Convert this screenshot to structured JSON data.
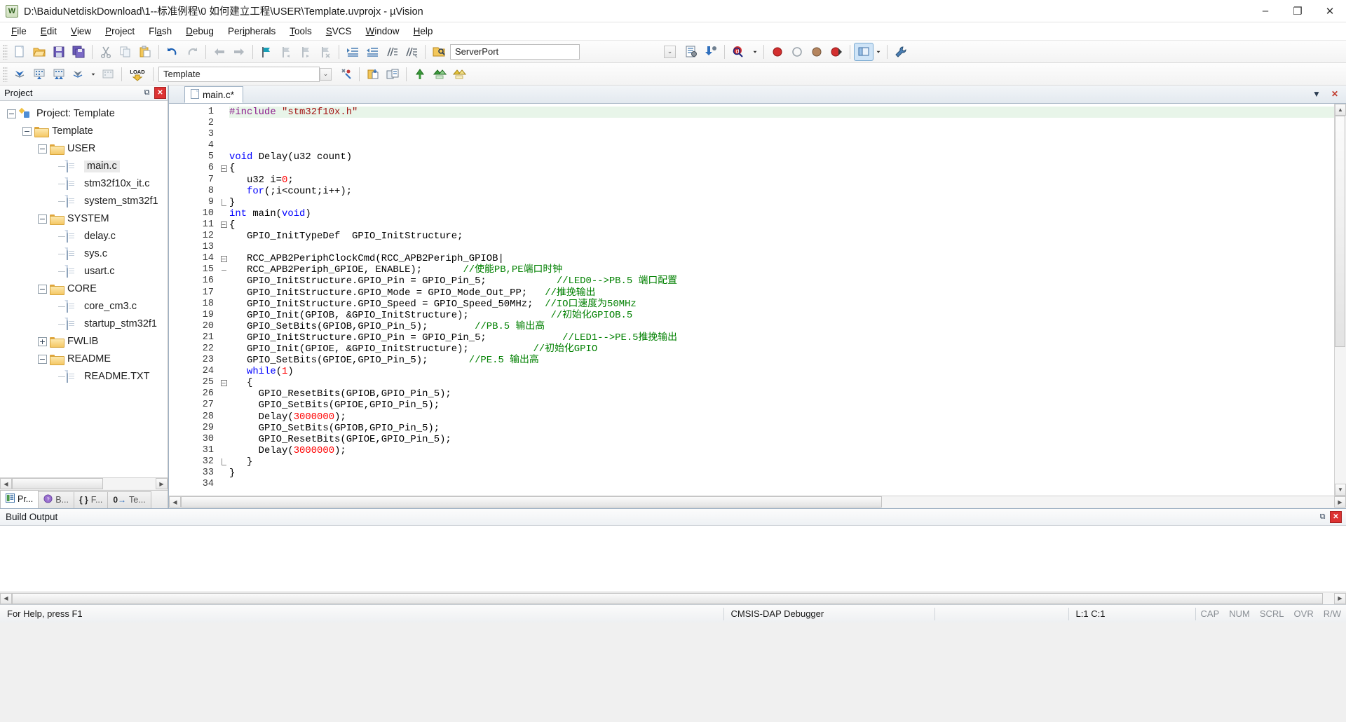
{
  "window": {
    "title": "D:\\BaiduNetdiskDownload\\1--标准例程\\0 如何建立工程\\USER\\Template.uvprojx - µVision",
    "app_icon": "uvision-logo-icon",
    "minimize": "–",
    "maximize": "❐",
    "close": "✕"
  },
  "menubar": [
    {
      "label": "File",
      "mnemonic": "F"
    },
    {
      "label": "Edit",
      "mnemonic": "E"
    },
    {
      "label": "View",
      "mnemonic": "V"
    },
    {
      "label": "Project",
      "mnemonic": "P"
    },
    {
      "label": "Flash",
      "mnemonic": "a"
    },
    {
      "label": "Debug",
      "mnemonic": "D"
    },
    {
      "label": "Peripherals",
      "mnemonic": "i"
    },
    {
      "label": "Tools",
      "mnemonic": "T"
    },
    {
      "label": "SVCS",
      "mnemonic": "S"
    },
    {
      "label": "Window",
      "mnemonic": "W"
    },
    {
      "label": "Help",
      "mnemonic": "H"
    }
  ],
  "toolbar_main": {
    "serverport_combo": {
      "value": "ServerPort",
      "placeholder": "ServerPort",
      "dropdown_arrow": "⌄"
    }
  },
  "toolbar_build": {
    "target_combo": {
      "value": "Template",
      "placeholder": "Template",
      "dropdown_arrow": "⌄"
    },
    "load_label": "LOAD"
  },
  "project_panel": {
    "title": "Project",
    "pin_glyph": "⧉",
    "close_glyph": "✕",
    "tree": [
      {
        "label": "Project: Template",
        "depth": 0,
        "type": "project",
        "expander": "−",
        "selected": false
      },
      {
        "label": "Template",
        "depth": 1,
        "type": "target",
        "expander": "−",
        "selected": false
      },
      {
        "label": "USER",
        "depth": 2,
        "type": "folder",
        "expander": "−",
        "selected": false
      },
      {
        "label": "main.c",
        "depth": 3,
        "type": "file",
        "expander": "",
        "selected": true
      },
      {
        "label": "stm32f10x_it.c",
        "depth": 3,
        "type": "file",
        "expander": "",
        "selected": false
      },
      {
        "label": "system_stm32f1",
        "depth": 3,
        "type": "file",
        "expander": "",
        "selected": false
      },
      {
        "label": "SYSTEM",
        "depth": 2,
        "type": "folder",
        "expander": "−",
        "selected": false
      },
      {
        "label": "delay.c",
        "depth": 3,
        "type": "file",
        "expander": "",
        "selected": false
      },
      {
        "label": "sys.c",
        "depth": 3,
        "type": "file",
        "expander": "",
        "selected": false
      },
      {
        "label": "usart.c",
        "depth": 3,
        "type": "file",
        "expander": "",
        "selected": false
      },
      {
        "label": "CORE",
        "depth": 2,
        "type": "folder",
        "expander": "−",
        "selected": false
      },
      {
        "label": "core_cm3.c",
        "depth": 3,
        "type": "file",
        "expander": "",
        "selected": false
      },
      {
        "label": "startup_stm32f1",
        "depth": 3,
        "type": "file",
        "expander": "",
        "selected": false
      },
      {
        "label": "FWLIB",
        "depth": 2,
        "type": "folder",
        "expander": "+",
        "selected": false
      },
      {
        "label": "README",
        "depth": 2,
        "type": "folder",
        "expander": "−",
        "selected": false
      },
      {
        "label": "README.TXT",
        "depth": 3,
        "type": "file",
        "expander": "",
        "selected": false
      }
    ],
    "tabs": [
      {
        "label": "Pr...",
        "icon": "project-icon",
        "active": true
      },
      {
        "label": "B...",
        "icon": "books-icon",
        "active": false
      },
      {
        "label": "F...",
        "icon": "functions-icon",
        "active": false
      },
      {
        "label": "Te...",
        "icon": "templates-icon",
        "active": false
      }
    ],
    "hscroll": {
      "left_arrow": "◀",
      "right_arrow": "▶"
    }
  },
  "editor": {
    "tabs": [
      {
        "label": "main.c*",
        "icon": "source-file-icon",
        "active": true
      }
    ],
    "tab_controls": {
      "minimize": "▼",
      "close": "✕"
    },
    "scroll": {
      "up_arrow": "▲",
      "down_arrow": "▼",
      "left_arrow": "◀",
      "right_arrow": "▶"
    },
    "lines": [
      {
        "n": 1,
        "fold": "",
        "current": true,
        "tokens": [
          {
            "t": "#include ",
            "c": "pre"
          },
          {
            "t": "\"stm32f10x.h\"",
            "c": "str"
          }
        ]
      },
      {
        "n": 2,
        "fold": "",
        "tokens": []
      },
      {
        "n": 3,
        "fold": "",
        "tokens": []
      },
      {
        "n": 4,
        "fold": "",
        "tokens": []
      },
      {
        "n": 5,
        "fold": "",
        "tokens": [
          {
            "t": "void ",
            "c": "kw"
          },
          {
            "t": "Delay(u32 count)",
            "c": ""
          }
        ]
      },
      {
        "n": 6,
        "fold": "open",
        "tokens": [
          {
            "t": "{",
            "c": ""
          }
        ]
      },
      {
        "n": 7,
        "fold": "",
        "tokens": [
          {
            "t": "   u32 i=",
            "c": ""
          },
          {
            "t": "0",
            "c": "num"
          },
          {
            "t": ";",
            "c": ""
          }
        ]
      },
      {
        "n": 8,
        "fold": "",
        "tokens": [
          {
            "t": "   ",
            "c": ""
          },
          {
            "t": "for",
            "c": "kw"
          },
          {
            "t": "(;i<count;i++);",
            "c": ""
          }
        ]
      },
      {
        "n": 9,
        "fold": "close",
        "tokens": [
          {
            "t": "}",
            "c": ""
          }
        ]
      },
      {
        "n": 10,
        "fold": "",
        "tokens": [
          {
            "t": "int ",
            "c": "kw"
          },
          {
            "t": "main(",
            "c": ""
          },
          {
            "t": "void",
            "c": "kw"
          },
          {
            "t": ")",
            "c": ""
          }
        ]
      },
      {
        "n": 11,
        "fold": "open",
        "tokens": [
          {
            "t": "{",
            "c": ""
          }
        ]
      },
      {
        "n": 12,
        "fold": "",
        "tokens": [
          {
            "t": "   GPIO_InitTypeDef  GPIO_InitStructure;",
            "c": ""
          }
        ]
      },
      {
        "n": 13,
        "fold": "",
        "tokens": []
      },
      {
        "n": 14,
        "fold": "open",
        "tokens": [
          {
            "t": "   RCC_APB2PeriphClockCmd(RCC_APB2Periph_GPIOB|",
            "c": ""
          }
        ]
      },
      {
        "n": 15,
        "fold": "close2",
        "tokens": [
          {
            "t": "   RCC_APB2Periph_GPIOE, ENABLE);       ",
            "c": ""
          },
          {
            "t": "//使能PB,PE端口时钟",
            "c": "cmt"
          }
        ]
      },
      {
        "n": 16,
        "fold": "",
        "tokens": [
          {
            "t": "   GPIO_InitStructure.GPIO_Pin = GPIO_Pin_5;            ",
            "c": ""
          },
          {
            "t": "//LED0-->PB.5 端口配置",
            "c": "cmt"
          }
        ]
      },
      {
        "n": 17,
        "fold": "",
        "tokens": [
          {
            "t": "   GPIO_InitStructure.GPIO_Mode = GPIO_Mode_Out_PP;   ",
            "c": ""
          },
          {
            "t": "//推挽输出",
            "c": "cmt"
          }
        ]
      },
      {
        "n": 18,
        "fold": "",
        "tokens": [
          {
            "t": "   GPIO_InitStructure.GPIO_Speed = GPIO_Speed_50MHz;  ",
            "c": ""
          },
          {
            "t": "//IO口速度为50MHz",
            "c": "cmt"
          }
        ]
      },
      {
        "n": 19,
        "fold": "",
        "tokens": [
          {
            "t": "   GPIO_Init(GPIOB, &GPIO_InitStructure);              ",
            "c": ""
          },
          {
            "t": "//初始化GPIOB.5",
            "c": "cmt"
          }
        ]
      },
      {
        "n": 20,
        "fold": "",
        "tokens": [
          {
            "t": "   GPIO_SetBits(GPIOB,GPIO_Pin_5);        ",
            "c": ""
          },
          {
            "t": "//PB.5 输出高",
            "c": "cmt"
          }
        ]
      },
      {
        "n": 21,
        "fold": "",
        "tokens": [
          {
            "t": "   GPIO_InitStructure.GPIO_Pin = GPIO_Pin_5;             ",
            "c": ""
          },
          {
            "t": "//LED1-->PE.5推挽输出",
            "c": "cmt"
          }
        ]
      },
      {
        "n": 22,
        "fold": "",
        "tokens": [
          {
            "t": "   GPIO_Init(GPIOE, &GPIO_InitStructure);           ",
            "c": ""
          },
          {
            "t": "//初始化GPIO",
            "c": "cmt"
          }
        ]
      },
      {
        "n": 23,
        "fold": "",
        "tokens": [
          {
            "t": "   GPIO_SetBits(GPIOE,GPIO_Pin_5);       ",
            "c": ""
          },
          {
            "t": "//PE.5 输出高",
            "c": "cmt"
          }
        ]
      },
      {
        "n": 24,
        "fold": "",
        "tokens": [
          {
            "t": "   ",
            "c": ""
          },
          {
            "t": "while",
            "c": "kw"
          },
          {
            "t": "(",
            "c": ""
          },
          {
            "t": "1",
            "c": "num"
          },
          {
            "t": ")",
            "c": ""
          }
        ]
      },
      {
        "n": 25,
        "fold": "open",
        "tokens": [
          {
            "t": "   {",
            "c": ""
          }
        ]
      },
      {
        "n": 26,
        "fold": "",
        "tokens": [
          {
            "t": "     GPIO_ResetBits(GPIOB,GPIO_Pin_5);",
            "c": ""
          }
        ]
      },
      {
        "n": 27,
        "fold": "",
        "tokens": [
          {
            "t": "     GPIO_SetBits(GPIOE,GPIO_Pin_5);",
            "c": ""
          }
        ]
      },
      {
        "n": 28,
        "fold": "",
        "tokens": [
          {
            "t": "     Delay(",
            "c": ""
          },
          {
            "t": "3000000",
            "c": "num"
          },
          {
            "t": ");",
            "c": ""
          }
        ]
      },
      {
        "n": 29,
        "fold": "",
        "tokens": [
          {
            "t": "     GPIO_SetBits(GPIOB,GPIO_Pin_5);",
            "c": ""
          }
        ]
      },
      {
        "n": 30,
        "fold": "",
        "tokens": [
          {
            "t": "     GPIO_ResetBits(GPIOE,GPIO_Pin_5);",
            "c": ""
          }
        ]
      },
      {
        "n": 31,
        "fold": "",
        "tokens": [
          {
            "t": "     Delay(",
            "c": ""
          },
          {
            "t": "3000000",
            "c": "num"
          },
          {
            "t": ");",
            "c": ""
          }
        ]
      },
      {
        "n": 32,
        "fold": "close",
        "tokens": [
          {
            "t": "   }",
            "c": ""
          }
        ]
      },
      {
        "n": 33,
        "fold": "",
        "tokens": [
          {
            "t": "}",
            "c": ""
          }
        ]
      },
      {
        "n": 34,
        "fold": "",
        "tokens": []
      }
    ]
  },
  "build_output": {
    "title": "Build Output",
    "pin_glyph": "⧉",
    "close_glyph": "✕",
    "content": "",
    "hscroll": {
      "left_arrow": "◀",
      "right_arrow": "▶"
    }
  },
  "statusbar": {
    "help_text": "For Help, press F1",
    "debugger": "CMSIS-DAP Debugger",
    "cursor_position": "L:1 C:1",
    "flags": [
      "CAP",
      "NUM",
      "SCRL",
      "OVR",
      "R/W"
    ]
  },
  "colors": {
    "keyword": "#0000ff",
    "string": "#a31515",
    "preprocessor": "#8b1a8b",
    "number": "#ff0000",
    "comment": "#008000",
    "current_line": "#e8f5e9",
    "selection": "#eaeaea",
    "close_red": "#dd3333"
  }
}
